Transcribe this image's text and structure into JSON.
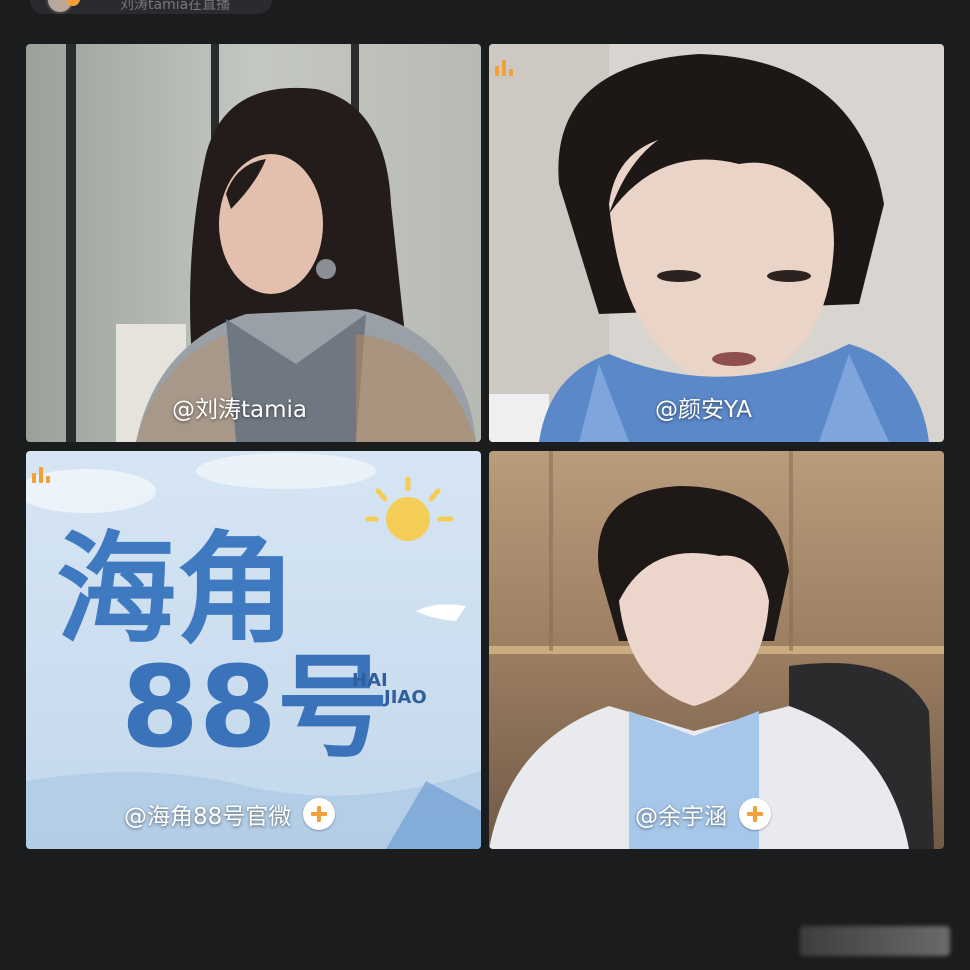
{
  "header": {
    "host_name": "刘涛tamia在直播"
  },
  "tiles": [
    {
      "label": "@刘涛tamia",
      "show_follow": false,
      "show_mic": false
    },
    {
      "label": "@颜安YA",
      "show_follow": false,
      "show_mic": true
    },
    {
      "label": "@海角88号官微",
      "show_follow": true,
      "show_mic": true
    },
    {
      "label": "@余宇涵",
      "show_follow": true,
      "show_mic": false
    }
  ],
  "poster": {
    "title_line1": "海角",
    "title_line2": "88号",
    "sub_line1": "HAI",
    "sub_line2": "JIAO"
  },
  "colors": {
    "background": "#1b1c1e",
    "accent": "#f2a13a",
    "label_text": "#ffffff"
  },
  "icons": {
    "mic": "mic-level-icon",
    "follow": "plus-follow-icon"
  }
}
